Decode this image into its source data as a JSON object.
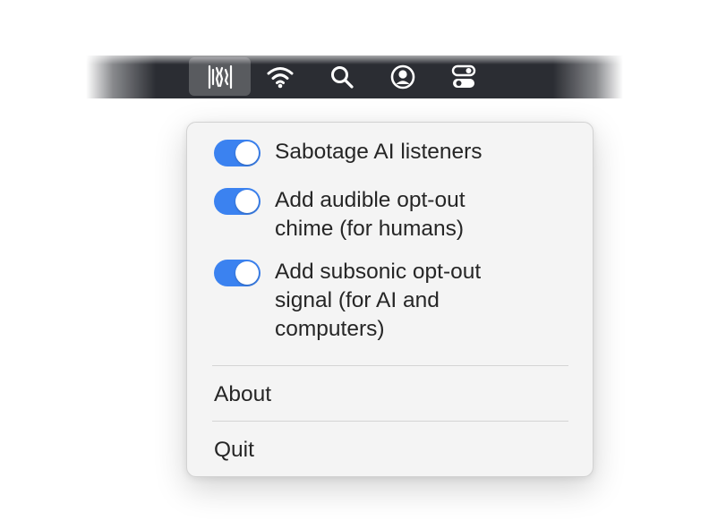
{
  "menubar": {
    "icons": [
      "waveform-app-icon",
      "wifi-icon",
      "search-icon",
      "user-account-icon",
      "control-center-icon"
    ]
  },
  "menu": {
    "toggles": [
      {
        "label_lines": [
          "Sabotage AI listeners"
        ],
        "enabled": true
      },
      {
        "label_lines": [
          "Add audible opt-out",
          "chime (for humans)"
        ],
        "enabled": true
      },
      {
        "label_lines": [
          "Add subsonic opt-out",
          "signal (for AI and",
          "computers)"
        ],
        "enabled": true
      }
    ],
    "about_label": "About",
    "quit_label": "Quit"
  },
  "colors": {
    "toggle_on": "#3b82f0",
    "menubar": "#2b2d33",
    "menu_bg": "#f4f4f4",
    "text": "#262626"
  }
}
